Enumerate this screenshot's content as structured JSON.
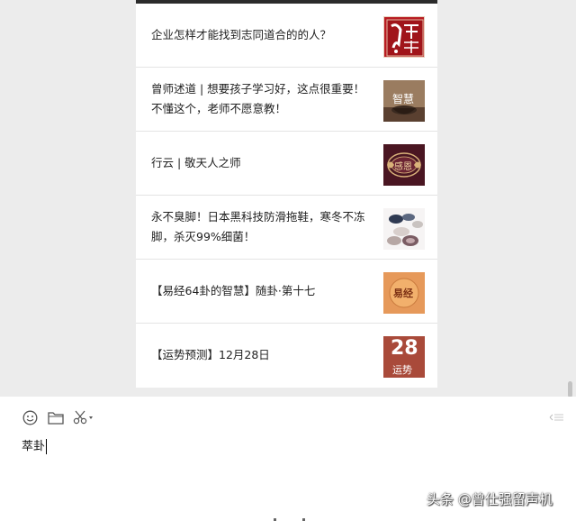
{
  "feed": {
    "articles": [
      {
        "title": "企业怎样才能找到志同道合的的人？",
        "thumb": {
          "icon": "brush-calligraphy-thumbnail",
          "text": "中國式管理",
          "bg": "#b81c22"
        }
      },
      {
        "title": "曾师述道 | 想要孩子学习好，这点很重要！\n不懂这个，老师不愿意教！",
        "thumb": {
          "icon": "tea-cup-thumbnail",
          "text": "智慧",
          "bg": "#8a6b50"
        }
      },
      {
        "title": "行云 | 敬天人之师",
        "thumb": {
          "icon": "ornate-frame-thumbnail",
          "text": "感恩",
          "bg": "#5a1e2a"
        }
      },
      {
        "title": "永不臭脚！日本黑科技防滑拖鞋，寒冬不冻\n脚，杀灭99%细菌！",
        "thumb": {
          "icon": "slippers-photo-thumbnail",
          "text": "",
          "bg": "#f4f2f2"
        }
      },
      {
        "title": "【易经64卦的智慧】随卦·第十七",
        "thumb": {
          "icon": "yijing-badge-thumbnail",
          "text": "易经",
          "bg": "#e89a5a"
        }
      },
      {
        "title": "【运势预测】12月28日",
        "thumb": {
          "icon": "calendar-fortune-thumbnail",
          "text": "28",
          "sub": "运势",
          "bg": "#a94a3a"
        }
      }
    ]
  },
  "compose": {
    "tools": [
      {
        "icon": "emoji-smiley-icon"
      },
      {
        "icon": "folder-icon"
      },
      {
        "icon": "scissors-screenshot-icon"
      }
    ],
    "input_text": "萃卦",
    "send_hint_icon": "send-indicator-icon"
  },
  "watermark": "头条 @曾仕强留声机"
}
